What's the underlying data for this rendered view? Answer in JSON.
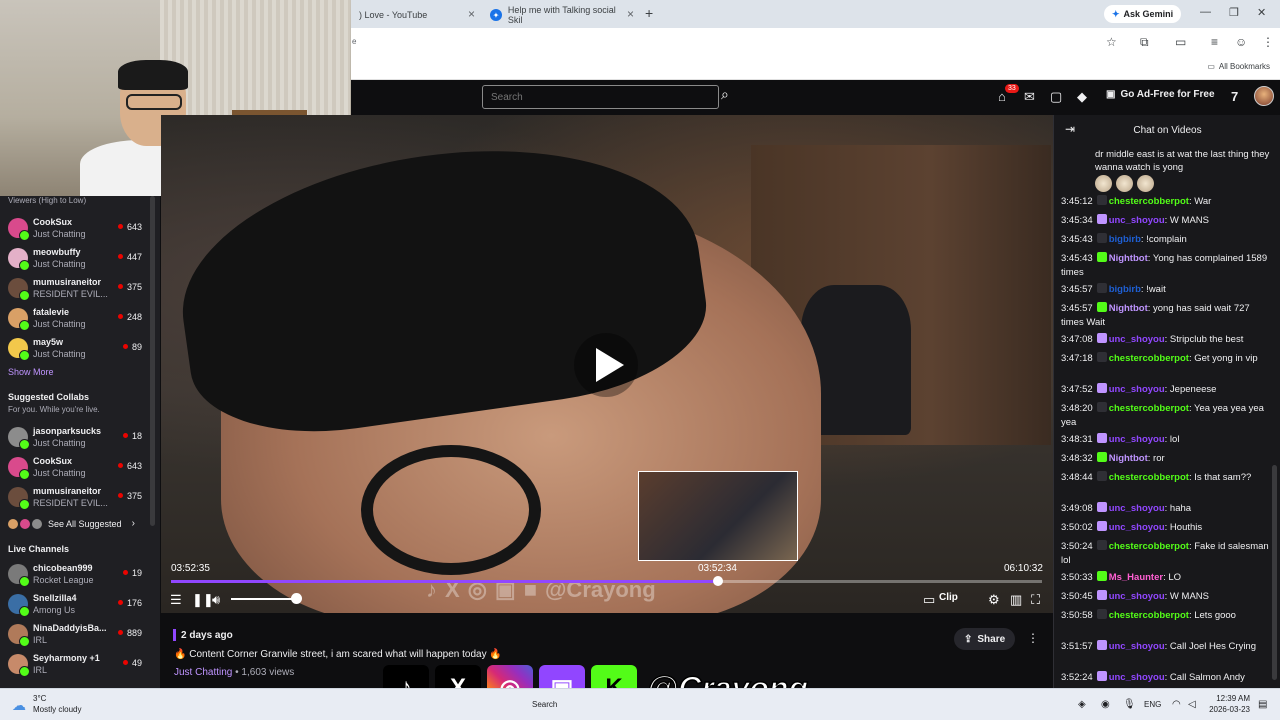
{
  "browser": {
    "tabs": [
      {
        "label": ") Love - YouTube"
      },
      {
        "label": "Help me with Talking social Skil"
      }
    ],
    "new_tab": "+",
    "ask_gemini": "Ask Gemini",
    "url_fragment": "e",
    "all_bookmarks": "All Bookmarks"
  },
  "header": {
    "search_placeholder": "Search",
    "notifications_count": "33",
    "ad_free_label": "Go Ad-Free for Free"
  },
  "sidebar": {
    "heading": "Viewers (High to Low)",
    "following": [
      {
        "name": "CookSux",
        "game": "Just Chatting",
        "viewers": "643",
        "color": "#d94a8c"
      },
      {
        "name": "meowbuffy",
        "game": "Just Chatting",
        "viewers": "447",
        "color": "#e3b0c8"
      },
      {
        "name": "mumusiraneitor",
        "game": "RESIDENT EVIL...",
        "viewers": "375",
        "color": "#6b4d3d"
      },
      {
        "name": "fatalevie",
        "game": "Just Chatting",
        "viewers": "248",
        "color": "#d9a066"
      },
      {
        "name": "may5w",
        "game": "Just Chatting",
        "viewers": "89",
        "color": "#f2c84b"
      }
    ],
    "show_more": "Show More",
    "suggested_title": "Suggested Collabs",
    "suggested_sub": "For you. While you're live.",
    "suggested": [
      {
        "name": "jasonparksucks",
        "game": "Just Chatting",
        "viewers": "18",
        "color": "#8c8c8c"
      },
      {
        "name": "CookSux",
        "game": "Just Chatting",
        "viewers": "643",
        "color": "#d94a8c"
      },
      {
        "name": "mumusiraneitor",
        "game": "RESIDENT EVIL...",
        "viewers": "375",
        "color": "#6b4d3d"
      }
    ],
    "see_all": "See All Suggested",
    "live_title": "Live Channels",
    "live": [
      {
        "name": "chicobean999",
        "game": "Rocket League",
        "viewers": "19",
        "color": "#7a7a7a"
      },
      {
        "name": "Snellzilla4",
        "game": "Among Us",
        "viewers": "176",
        "color": "#3a6ea5"
      },
      {
        "name": "NinaDaddyisBa...",
        "game": "IRL",
        "viewers": "889",
        "color": "#b07a5a"
      },
      {
        "name": "Seyharmony +1",
        "game": "IRL",
        "viewers": "49",
        "color": "#c78a6a"
      }
    ]
  },
  "video": {
    "time_current": "03:52:35",
    "time_preview": "03:52:34",
    "time_total": "06:10:32",
    "progress_fraction": 0.628,
    "volume_fraction": 0.85,
    "clip_label": "Clip",
    "overlay_handle": "@Crayong"
  },
  "details": {
    "posted": "2 days ago",
    "title": "🔥 Content Corner Granvile street, i am scared what will happen today 🔥",
    "category": "Just Chatting",
    "views": " • 1,603 views",
    "share": "Share"
  },
  "chat": {
    "title": "Chat on Videos",
    "first_message": "dr middle east is at wat the last thing they wanna watch is yong",
    "messages": [
      {
        "ts": "3:45:12",
        "user": "chestercobberpot",
        "text": ": War",
        "color": "#53fc18",
        "badge": "dark"
      },
      {
        "ts": "3:45:34",
        "user": "unc_shoyou",
        "text": ": W MANS",
        "color": "#9147ff",
        "badge": "purple"
      },
      {
        "ts": "3:45:43",
        "user": "bigbirb",
        "text": ": !complain",
        "color": "#1e5fd4",
        "badge": "dark"
      },
      {
        "ts": "3:45:43",
        "user": "Nightbot",
        "text": ": Yong has complained 1589 times",
        "color": "#bf94ff",
        "badge": "green"
      },
      {
        "ts": "3:45:57",
        "user": "bigbirb",
        "text": ": !wait",
        "color": "#1e5fd4",
        "badge": "dark"
      },
      {
        "ts": "3:45:57",
        "user": "Nightbot",
        "text": ": yong has said wait 727 times Wait",
        "color": "#bf94ff",
        "badge": "green"
      },
      {
        "ts": "3:47:08",
        "user": "unc_shoyou",
        "text": ": Stripclub the best",
        "color": "#9147ff",
        "badge": "purple"
      },
      {
        "ts": "3:47:18",
        "user": "chestercobberpot",
        "text": ": Get yong in vip",
        "color": "#53fc18",
        "badge": "dark"
      },
      {
        "ts": "3:47:52",
        "user": "unc_shoyou",
        "text": ": Jepeneese",
        "color": "#9147ff",
        "badge": "purple"
      },
      {
        "ts": "3:48:20",
        "user": "chestercobberpot",
        "text": ": Yea yea yea yea yea",
        "color": "#53fc18",
        "badge": "dark"
      },
      {
        "ts": "3:48:31",
        "user": "unc_shoyou",
        "text": ": lol",
        "color": "#9147ff",
        "badge": "purple"
      },
      {
        "ts": "3:48:32",
        "user": "Nightbot",
        "text": ": ror",
        "color": "#bf94ff",
        "badge": "green"
      },
      {
        "ts": "3:48:44",
        "user": "chestercobberpot",
        "text": ": Is that sam??",
        "color": "#53fc18",
        "badge": "dark"
      },
      {
        "ts": "3:49:08",
        "user": "unc_shoyou",
        "text": ": haha",
        "color": "#9147ff",
        "badge": "purple"
      },
      {
        "ts": "3:50:02",
        "user": "unc_shoyou",
        "text": ": Houthis",
        "color": "#9147ff",
        "badge": "purple"
      },
      {
        "ts": "3:50:24",
        "user": "chestercobberpot",
        "text": ": Fake id salesman lol",
        "color": "#53fc18",
        "badge": "dark"
      },
      {
        "ts": "3:50:33",
        "user": "Ms_Haunter",
        "text": ": LO",
        "color": "#ff5fd2",
        "badge": "green"
      },
      {
        "ts": "3:50:45",
        "user": "unc_shoyou",
        "text": ": W MANS",
        "color": "#9147ff",
        "badge": "purple"
      },
      {
        "ts": "3:50:58",
        "user": "chestercobberpot",
        "text": ": Lets gooo",
        "color": "#53fc18",
        "badge": "dark"
      },
      {
        "ts": "3:51:57",
        "user": "unc_shoyou",
        "text": ": Call Joel Hes Crying",
        "color": "#9147ff",
        "badge": "purple"
      },
      {
        "ts": "3:52:24",
        "user": "unc_shoyou",
        "text": ": Call Salmon Andy",
        "color": "#9147ff",
        "badge": "purple"
      }
    ]
  },
  "taskbar": {
    "temp": "3°C",
    "weather": "Mostly cloudy",
    "search": "Search",
    "lang": "ENG",
    "time": "12:39 AM",
    "date": "2026-03-23"
  }
}
